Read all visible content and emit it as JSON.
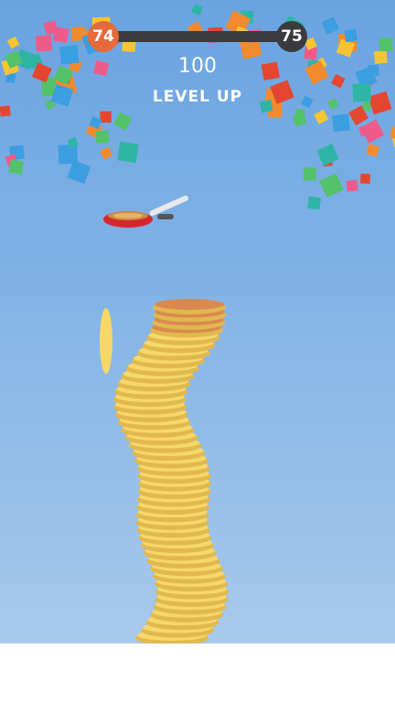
{
  "hud": {
    "current_level": "74",
    "next_level": "75",
    "progress": 1.0,
    "score": "100",
    "message": "LEVEL UP"
  },
  "colors": {
    "sky_top": "#6aa3e0",
    "sky_bottom": "#a8c9ea",
    "accent": "#e66a3c",
    "bar": "#3a3a3f",
    "pancake": "#f6d768",
    "pancake_top": "#d9894e",
    "pan": "#d9262d"
  }
}
